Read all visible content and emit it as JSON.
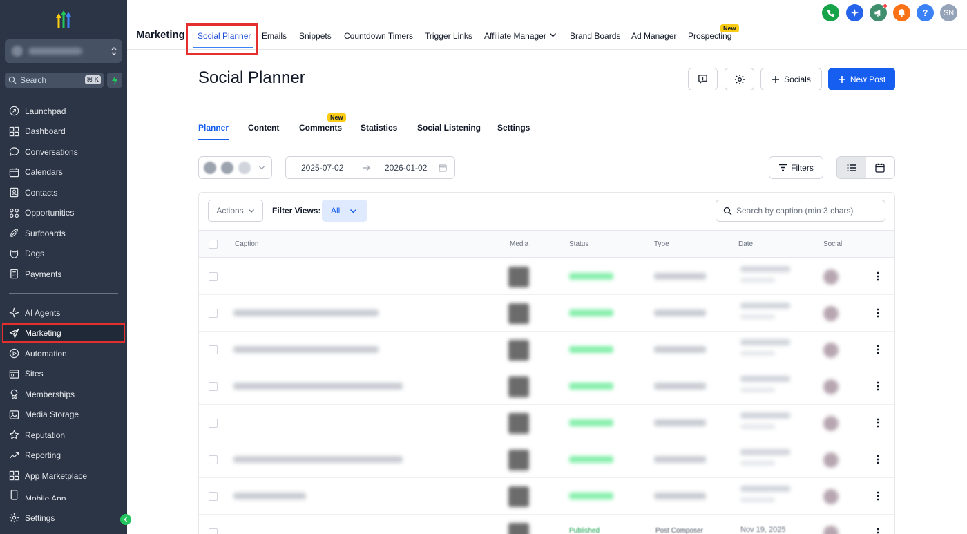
{
  "sidebar": {
    "search_placeholder": "Search",
    "search_shortcut": "⌘ K",
    "items": [
      {
        "label": "Launchpad",
        "icon": "launchpad-icon"
      },
      {
        "label": "Dashboard",
        "icon": "dashboard-icon"
      },
      {
        "label": "Conversations",
        "icon": "chat-icon"
      },
      {
        "label": "Calendars",
        "icon": "calendar-icon"
      },
      {
        "label": "Contacts",
        "icon": "contacts-icon"
      },
      {
        "label": "Opportunities",
        "icon": "opportunities-icon"
      },
      {
        "label": "Surfboards",
        "icon": "surfboard-icon"
      },
      {
        "label": "Dogs",
        "icon": "dog-icon"
      },
      {
        "label": "Payments",
        "icon": "payments-icon"
      }
    ],
    "items2": [
      {
        "label": "AI Agents",
        "icon": "ai-agents-icon"
      },
      {
        "label": "Marketing",
        "icon": "send-icon"
      },
      {
        "label": "Automation",
        "icon": "automation-icon"
      },
      {
        "label": "Sites",
        "icon": "sites-icon"
      },
      {
        "label": "Memberships",
        "icon": "memberships-icon"
      },
      {
        "label": "Media Storage",
        "icon": "media-icon"
      },
      {
        "label": "Reputation",
        "icon": "star-icon"
      },
      {
        "label": "Reporting",
        "icon": "reporting-icon"
      },
      {
        "label": "App Marketplace",
        "icon": "apps-icon"
      },
      {
        "label": "Mobile App",
        "icon": "mobile-icon"
      }
    ],
    "settings_label": "Settings",
    "active_item": "Marketing"
  },
  "topbar": {
    "section_title": "Marketing",
    "tabs": [
      "Social Planner",
      "Emails",
      "Snippets",
      "Countdown Timers",
      "Trigger Links",
      "Affiliate Manager",
      "Brand Boards",
      "Ad Manager",
      "Prospecting"
    ],
    "active_tab": "Social Planner",
    "new_badge": "New",
    "user_initials": "SN",
    "colors": {
      "phone": "#16a34a",
      "ai": "#2563eb",
      "announce": "#3f8f6f",
      "bell": "#f97316",
      "help": "#3b82f6"
    }
  },
  "page": {
    "title": "Social Planner",
    "socials_button": "Socials",
    "new_post_button": "New Post",
    "subtabs": [
      "Planner",
      "Content",
      "Comments",
      "Statistics",
      "Social Listening",
      "Settings"
    ],
    "active_subtab": "Planner",
    "comments_badge": "New",
    "date_from": "2025-07-02",
    "date_to": "2026-01-02",
    "filters_button": "Filters",
    "actions_button": "Actions",
    "filter_views_label": "Filter Views:",
    "filter_views_value": "All",
    "search_placeholder": "Search by caption (min 3 chars)",
    "columns": [
      "Caption",
      "Media",
      "Status",
      "Type",
      "Date",
      "Social"
    ],
    "last_row_status": "Published",
    "last_row_type": "Post Composer",
    "last_row_date": "Nov 19, 2025",
    "accent": "#155eef"
  }
}
